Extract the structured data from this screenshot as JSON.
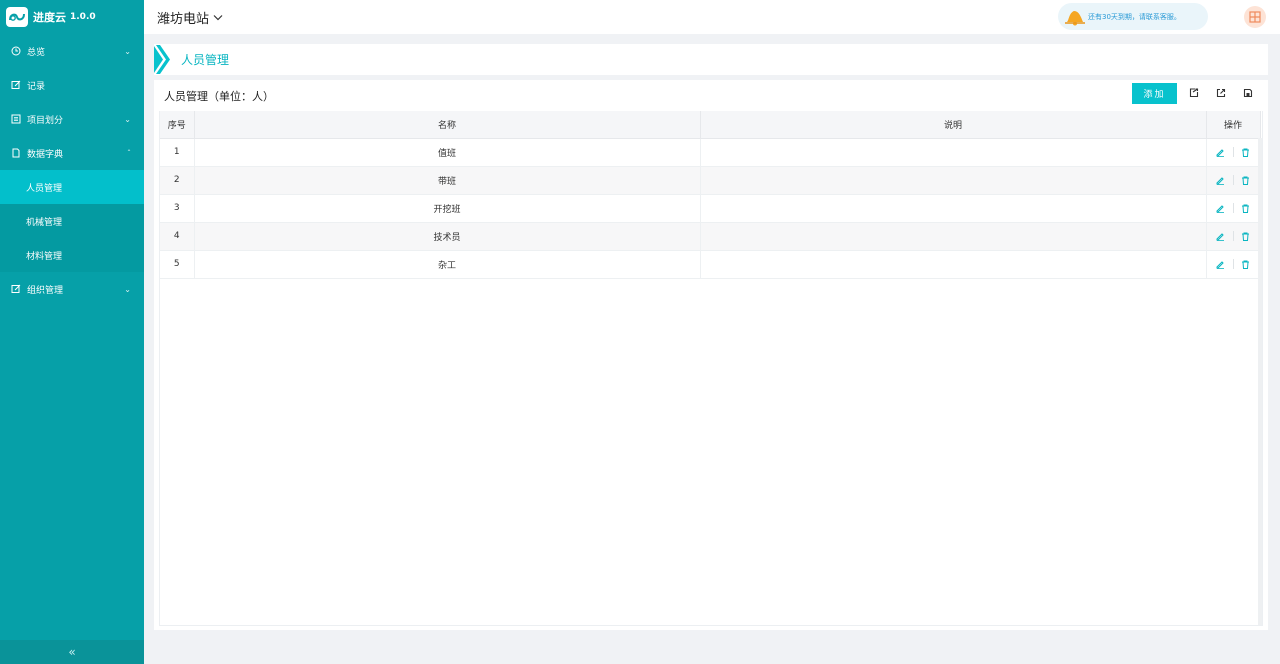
{
  "app": {
    "name": "进度云",
    "version": "1.0.0"
  },
  "header": {
    "station": "潍坊电站",
    "notice": "还有30天到期，请联系客服。"
  },
  "sidebar": {
    "items": [
      {
        "label": "总览",
        "icon": "clock-icon",
        "expandable": true
      },
      {
        "label": "记录",
        "icon": "edit-icon",
        "expandable": false
      },
      {
        "label": "项目划分",
        "icon": "list-icon",
        "expandable": true
      },
      {
        "label": "数据字典",
        "icon": "file-icon",
        "expandable": true,
        "expanded": true
      },
      {
        "label": "组织管理",
        "icon": "edit-icon",
        "expandable": true
      }
    ],
    "submenu": [
      {
        "label": "人员管理",
        "active": true
      },
      {
        "label": "机械管理",
        "active": false
      },
      {
        "label": "材料管理",
        "active": false
      }
    ],
    "collapse_label": "«"
  },
  "breadcrumb": {
    "title": "人员管理"
  },
  "panel": {
    "title": "人员管理（单位：人）",
    "add_label": "添加",
    "tools": [
      "import-icon",
      "export-icon",
      "save-icon"
    ]
  },
  "table": {
    "columns": [
      "序号",
      "名称",
      "说明",
      "操作"
    ],
    "rows": [
      {
        "index": "1",
        "name": "值班",
        "desc": ""
      },
      {
        "index": "2",
        "name": "带班",
        "desc": ""
      },
      {
        "index": "3",
        "name": "开挖班",
        "desc": ""
      },
      {
        "index": "4",
        "name": "技术员",
        "desc": ""
      },
      {
        "index": "5",
        "name": "杂工",
        "desc": ""
      }
    ]
  },
  "colors": {
    "sidebar": "#06a0a8",
    "active": "#03bfcb",
    "accent": "#08b5c1",
    "notice_text": "#2a9ad6",
    "avatar_bg": "#fde3d6"
  }
}
